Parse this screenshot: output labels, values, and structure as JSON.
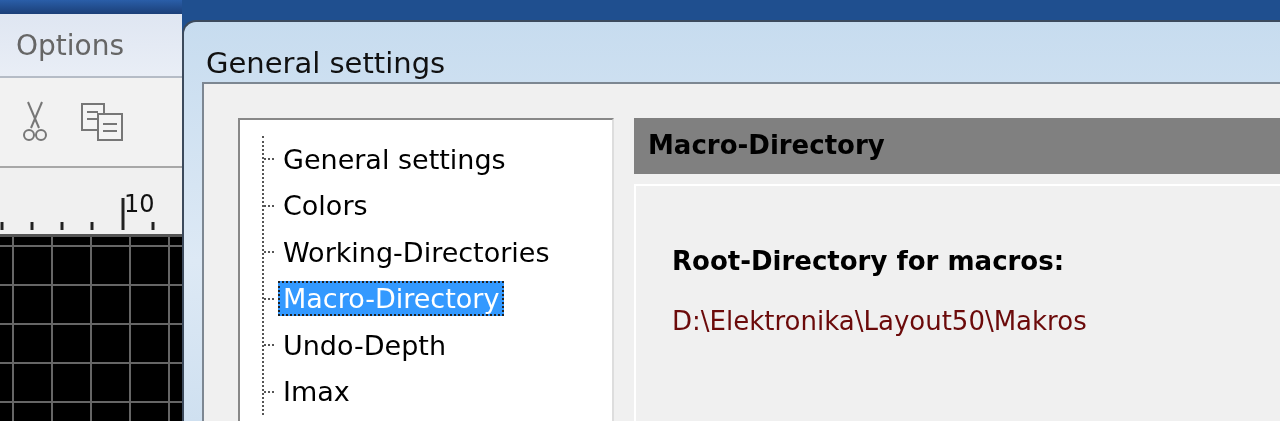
{
  "app": {
    "menu": [
      {
        "label": "Options"
      }
    ],
    "ruler_label": "10"
  },
  "dialog": {
    "title": "General settings",
    "tree": [
      {
        "label": "General settings",
        "selected": false
      },
      {
        "label": "Colors",
        "selected": false
      },
      {
        "label": "Working-Directories",
        "selected": false
      },
      {
        "label": "Macro-Directory",
        "selected": true
      },
      {
        "label": "Undo-Depth",
        "selected": false
      },
      {
        "label": "Imax",
        "selected": false
      }
    ],
    "panel": {
      "header": "Macro-Directory",
      "label": "Root-Directory for macros:",
      "value": "D:\\Elektronika\\Layout50\\Makros"
    }
  }
}
